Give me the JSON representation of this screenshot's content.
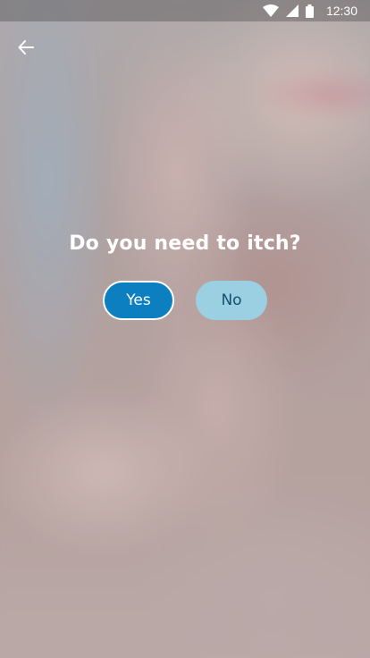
{
  "status_bar": {
    "time": "12:30",
    "icons": [
      "wifi-icon",
      "cell-signal-icon",
      "battery-icon"
    ]
  },
  "header": {
    "back_icon": "arrow-left-icon"
  },
  "main": {
    "question": "Do you need to itch?",
    "yes_label": "Yes",
    "no_label": "No"
  },
  "colors": {
    "yes_button": "#0b7fc0",
    "no_button": "#9bcfe2",
    "no_text": "#14506f",
    "text": "#ffffff"
  }
}
